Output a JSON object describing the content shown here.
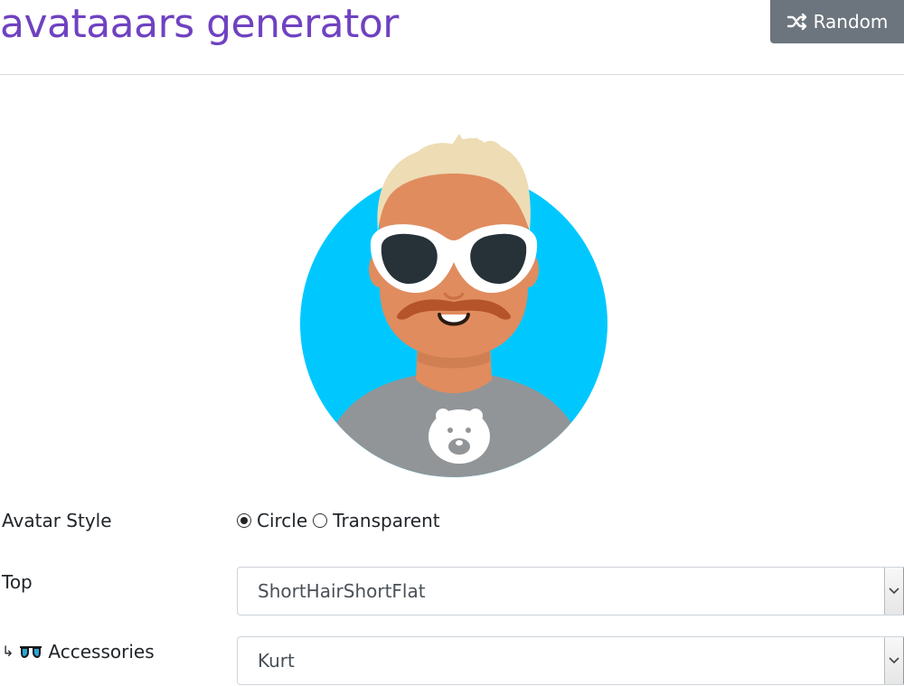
{
  "header": {
    "title": "avataaars generator",
    "random_label": "Random",
    "random_icon": "shuffle-icon"
  },
  "avatar": {
    "background_color": "#00c8ff",
    "skin_color": "#e08c5e",
    "hair_color": "#eedcb4",
    "shirt_color": "#929598",
    "glasses_frame_color": "#ffffff",
    "mustache_color": "#b5532a",
    "graphic_icon": "bear-icon"
  },
  "form": {
    "avatar_style": {
      "label": "Avatar Style",
      "options": [
        "Circle",
        "Transparent"
      ],
      "selected": "Circle"
    },
    "top": {
      "label": "Top",
      "value": "ShortHairShortFlat"
    },
    "accessories": {
      "prefix": "↳",
      "icon": "sunglasses-icon",
      "label": "Accessories",
      "value": "Kurt"
    }
  },
  "colors": {
    "title": "#6f42c1",
    "button_bg": "#6c757d"
  }
}
